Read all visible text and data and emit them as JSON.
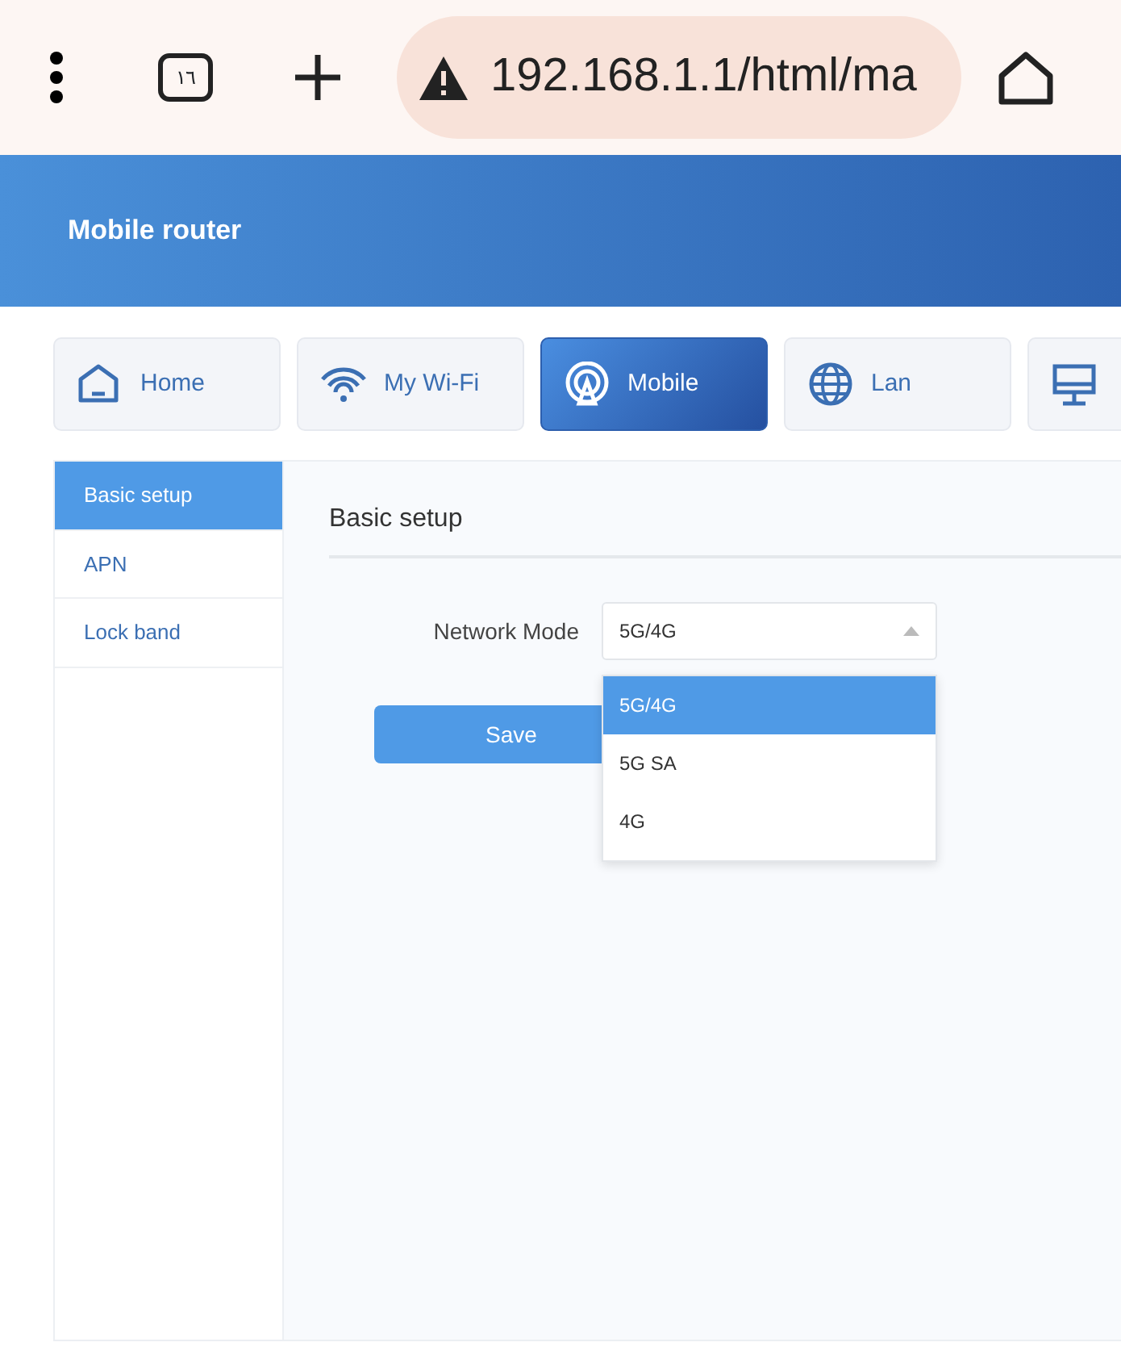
{
  "browser_bar": {
    "tab_count": "١٦",
    "url": "192.168.1.1/html/ma"
  },
  "header": {
    "title": "Mobile router"
  },
  "tabs": [
    {
      "kind": "home",
      "label": "Home",
      "selected": false
    },
    {
      "kind": "wifi",
      "label": "My Wi-Fi",
      "selected": false
    },
    {
      "kind": "mobile",
      "label": "Mobile",
      "selected": true
    },
    {
      "kind": "lan",
      "label": "Lan",
      "selected": false
    },
    {
      "kind": "monitor",
      "selected": false
    }
  ],
  "sidebar": {
    "items": [
      {
        "label": "Basic setup",
        "selected": true
      },
      {
        "label": "APN",
        "selected": false
      },
      {
        "label": "Lock band",
        "selected": false
      }
    ]
  },
  "panel": {
    "title": "Basic setup",
    "field_label": "Network Mode",
    "value": "5G/4G",
    "expanded": true,
    "options": [
      {
        "label": "5G/4G",
        "selected": true
      },
      {
        "label": "5G SA",
        "selected": false
      },
      {
        "label": "4G",
        "selected": false
      }
    ],
    "save_button": "Save"
  }
}
